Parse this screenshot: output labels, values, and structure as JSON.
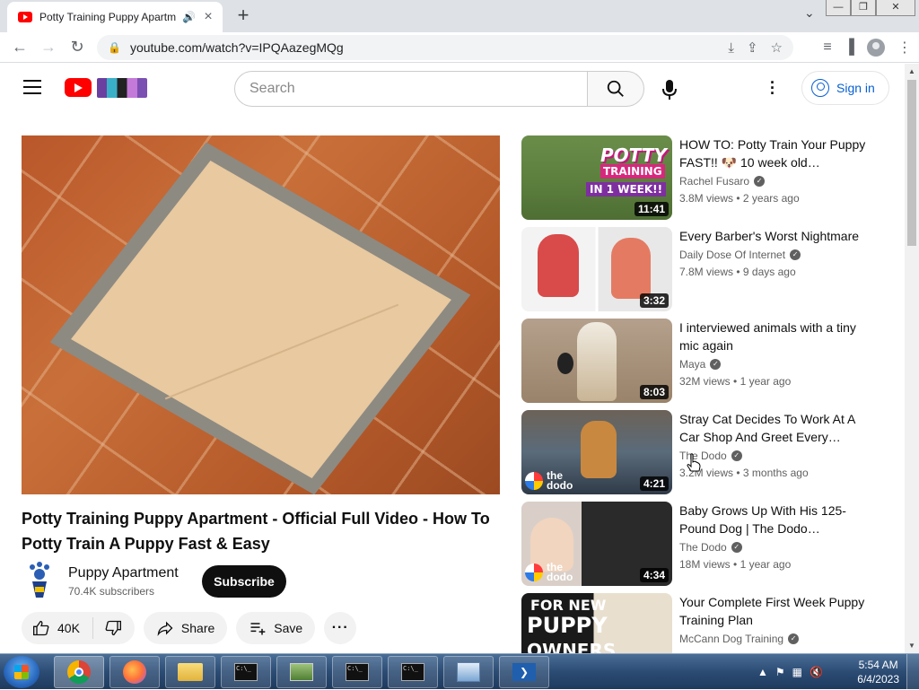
{
  "browser": {
    "tab_title": "Potty Training Puppy Apartm",
    "url": "youtube.com/watch?v=IPQAazegMQg"
  },
  "header": {
    "search_placeholder": "Search",
    "signin_label": "Sign in"
  },
  "video": {
    "title": "Potty Training Puppy Apartment - Official Full Video - How To Potty Train A Puppy Fast & Easy",
    "channel": "Puppy Apartment",
    "subscribers": "70.4K subscribers",
    "subscribe_label": "Subscribe",
    "likes": "40K",
    "share_label": "Share",
    "save_label": "Save"
  },
  "recommendations": [
    {
      "title": "HOW TO: Potty Train Your Puppy FAST!! 🐶 10 week old…",
      "channel": "Rachel Fusaro",
      "views": "3.8M views",
      "age": "2 years ago",
      "duration": "11:41",
      "thumb_text": [
        "POTTY",
        "TRAINING",
        "IN 1 WEEK!!"
      ]
    },
    {
      "title": "Every Barber's Worst Nightmare",
      "channel": "Daily Dose Of Internet",
      "views": "7.8M views",
      "age": "9 days ago",
      "duration": "3:32"
    },
    {
      "title": "I interviewed animals with a tiny mic again",
      "channel": "Maya",
      "views": "32M views",
      "age": "1 year ago",
      "duration": "8:03"
    },
    {
      "title": "Stray Cat Decides To Work At A Car Shop And Greet Every…",
      "channel": "The Dodo",
      "views": "3.2M views",
      "age": "3 months ago",
      "duration": "4:21",
      "thumb_text": [
        "the",
        "dodo"
      ]
    },
    {
      "title": "Baby Grows Up With His 125-Pound Dog | The Dodo…",
      "channel": "The Dodo",
      "views": "18M views",
      "age": "1 year ago",
      "duration": "4:34",
      "thumb_text": [
        "the",
        "dodo"
      ]
    },
    {
      "title": "Your Complete First Week Puppy Training Plan",
      "channel": "McCann Dog Training",
      "views": "",
      "age": "",
      "duration": "",
      "thumb_text": [
        "FOR NEW",
        "PUPPY",
        "OWNERS"
      ]
    }
  ],
  "taskbar": {
    "time": "5:54 AM",
    "date": "6/4/2023",
    "cmd_text": "C:\\_"
  },
  "colors": {
    "youtube_red": "#ff0000",
    "link_blue": "#065fd4",
    "subscribe_bg": "#0f0f0f"
  }
}
